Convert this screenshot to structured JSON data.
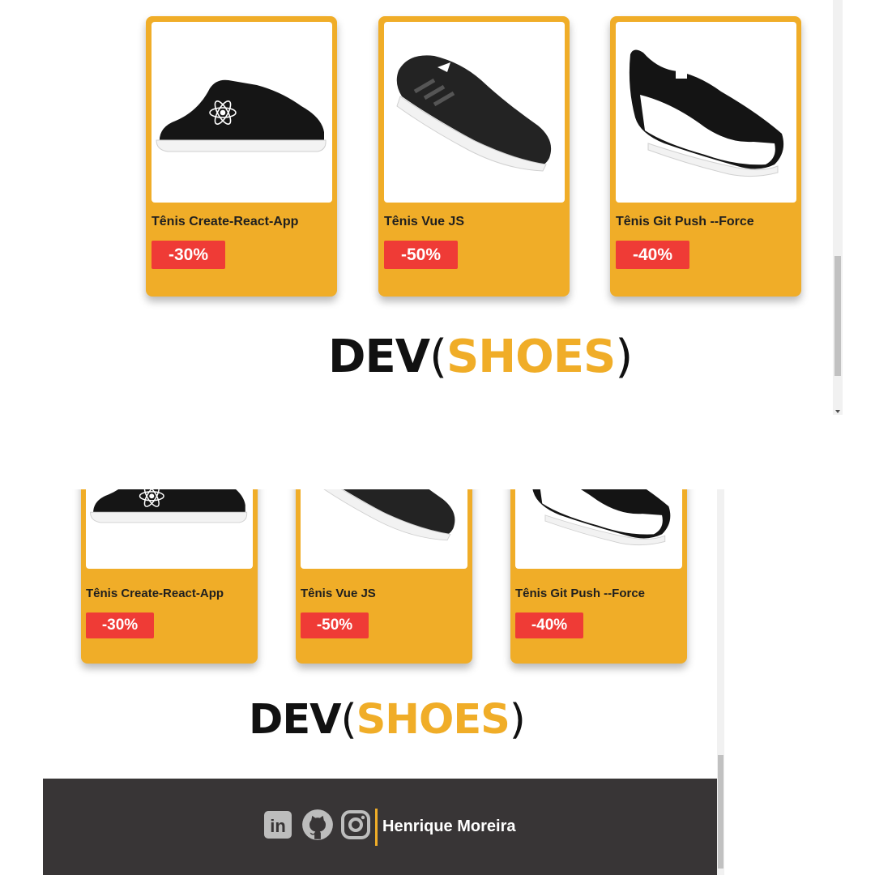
{
  "products": [
    {
      "name": "Tênis Create-React-App",
      "discount": "-30%"
    },
    {
      "name": "Tênis Vue JS",
      "discount": "-50%"
    },
    {
      "name": "Tênis Git Push --Force",
      "discount": "-40%"
    }
  ],
  "logo": {
    "dev": "DEV",
    "open": "(",
    "shoes": "SHOES",
    "close": ")"
  },
  "footer": {
    "author": "Henrique Moreira",
    "icons": [
      "linkedin-icon",
      "github-icon",
      "instagram-icon"
    ],
    "linkedin_text": "in"
  },
  "colors": {
    "accent": "#f0ad28",
    "badge": "#ef3b36",
    "footer_bg": "#383536"
  }
}
